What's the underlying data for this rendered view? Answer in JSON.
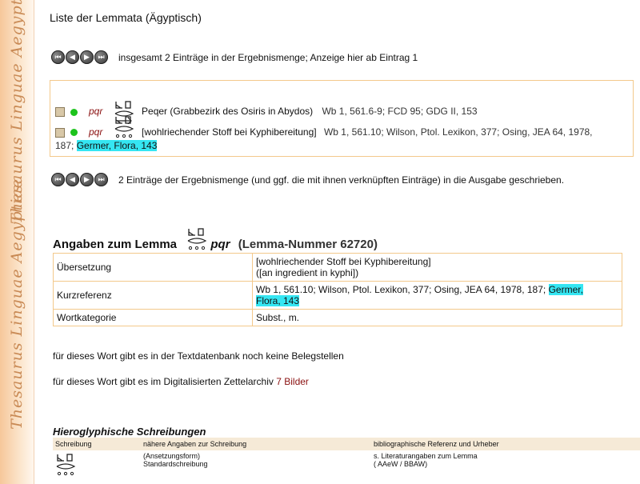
{
  "sidebar": {
    "brand_top": "Thesaurus Linguae Aegyptiae",
    "brand_bottom": "Thesaurus Linguae Aegyptiae"
  },
  "page": {
    "title": "Liste der Lemmata (Ägyptisch)"
  },
  "nav": {
    "buttons": [
      "first",
      "previous",
      "next",
      "last"
    ],
    "summary": "insgesamt 2 Einträge in der Ergebnismenge; Anzeige hier ab Eintrag 1",
    "export_text": "2 Einträge der Ergebnismenge (und ggf. die mit ihnen verknüpften Einträge) in die Ausgabe geschrieben."
  },
  "results": [
    {
      "translit": "pqr",
      "name": "Peqer (Grabbezirk des Osiris in Abydos)",
      "ref": "Wb 1, 561.6-9; FCD 95; GDG II, 153"
    },
    {
      "translit": "pqr",
      "name": "[wohlriechender Stoff bei Kyphibereitung]",
      "ref": "Wb 1, 561.10; Wilson, Ptol. Lexikon, 377; Osing, JEA 64, 1978,",
      "ref2": "187;",
      "ref_hl": "Germer, Flora, 143"
    }
  ],
  "lemma": {
    "heading": "Angaben zum Lemma",
    "translit": "pqr",
    "number": "(Lemma-Nummer 62720)",
    "rows": {
      "uebersetzung_label": "Übersetzung",
      "uebersetzung_1": "[wohlriechender Stoff bei Kyphibereitung]",
      "uebersetzung_2": "([an ingredient in kyphi])",
      "kurzref_label": "Kurzreferenz",
      "kurzref_value": "Wb 1, 561.10; Wilson, Ptol. Lexikon, 377; Osing, JEA 64, 1978, 187;",
      "kurzref_hl1": "Germer,",
      "kurzref_hl2": "Flora, 143",
      "wortkat_label": "Wortkategorie",
      "wortkat_value": "Subst., m."
    }
  },
  "info": {
    "belegstellen": "für dieses Wort gibt es in der Textdatenbank noch keine Belegstellen",
    "zettel_prefix": "für dieses Wort gibt es im Digitalisierten Zettelarchiv",
    "zettel_count": "7 Bilder"
  },
  "hiero": {
    "title": "Hieroglyphische Schreibungen",
    "headers": [
      "Schreibung",
      "nähere Angaben zur Schreibung",
      "bibliographische Referenz und Urheber"
    ],
    "row": {
      "detail_1": "(Ansetzungsform)",
      "detail_2": "Standardschreibung",
      "ref_1": "s. Literaturangaben zum Lemma",
      "ref_2": "( AAeW / BBAW)"
    }
  }
}
